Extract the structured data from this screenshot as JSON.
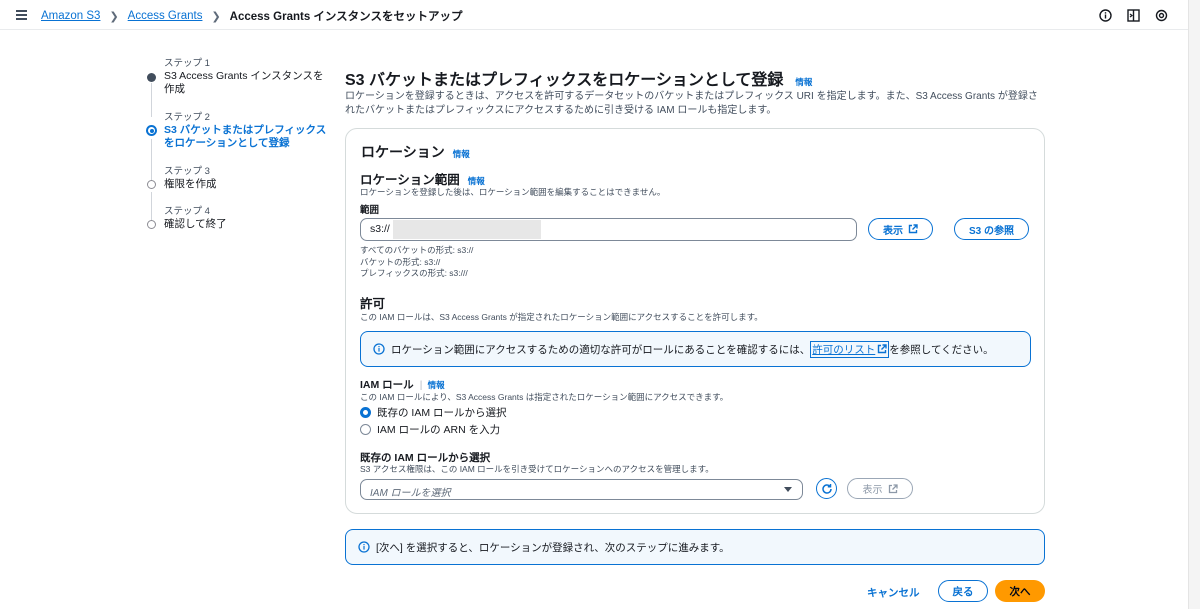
{
  "breadcrumb": {
    "items": [
      "Amazon S3",
      "Access Grants"
    ],
    "current": "Access Grants インスタンスをセットアップ"
  },
  "top_icons": [
    "info-circle-icon",
    "side-panel-icon",
    "settings-icon"
  ],
  "steps": [
    {
      "num": "ステップ 1",
      "title": "S3 Access Grants インスタンスを作成",
      "state": "done"
    },
    {
      "num": "ステップ 2",
      "title": "S3 バケットまたはプレフィックスをロケーションとして登録",
      "state": "active"
    },
    {
      "num": "ステップ 3",
      "title": "権限を作成",
      "state": "todo"
    },
    {
      "num": "ステップ 4",
      "title": "確認して終了",
      "state": "todo"
    }
  ],
  "main": {
    "title": "S3 バケットまたはプレフィックスをロケーションとして登録",
    "info": "情報",
    "description": "ロケーションを登録するときは、アクセスを許可するデータセットのバケットまたはプレフィックス URI を指定します。また、S3 Access Grants が登録されたバケットまたはプレフィックスにアクセスするために引き受ける IAM ロールも指定します。"
  },
  "location": {
    "heading": "ロケーション",
    "info": "情報",
    "scope_heading": "ロケーション範囲",
    "scope_info": "情報",
    "scope_desc": "ロケーションを登録した後は、ロケーション範囲を編集することはできません。",
    "field_label": "範囲",
    "field_value": "s3://",
    "view_button": "表示",
    "browse_button": "S3 の参照",
    "hints": [
      "すべてのバケットの形式: s3://",
      "バケットの形式: s3://",
      "プレフィックスの形式: s3:///"
    ]
  },
  "permission": {
    "heading": "許可",
    "desc": "この IAM ロールは、S3 Access Grants が指定されたロケーション範囲にアクセスすることを許可します。",
    "alert_before": "ロケーション範囲にアクセスするための適切な許可がロールにあることを確認するには、",
    "alert_link": "許可のリスト",
    "alert_after": "を参照してください。",
    "iam_label": "IAM ロール",
    "iam_info": "情報",
    "iam_desc": "この IAM ロールにより、S3 Access Grants は指定されたロケーション範囲にアクセスできます。",
    "radio_existing": "既存の IAM ロールから選択",
    "radio_arn": "IAM ロールの ARN を入力",
    "select_heading": "既存の IAM ロールから選択",
    "select_desc": "S3 アクセス権限は、この IAM ロールを引き受けてロケーションへのアクセスを管理します。",
    "select_placeholder": "IAM ロールを選択",
    "view_button": "表示"
  },
  "footer": {
    "alert": "[次へ] を選択すると、ロケーションが登録され、次のステップに進みます。",
    "cancel": "キャンセル",
    "back": "戻る",
    "next": "次へ"
  },
  "colors": {
    "accent": "#0972d3",
    "primary_button": "#ff9900",
    "alert_bg": "#f2f8fd"
  }
}
